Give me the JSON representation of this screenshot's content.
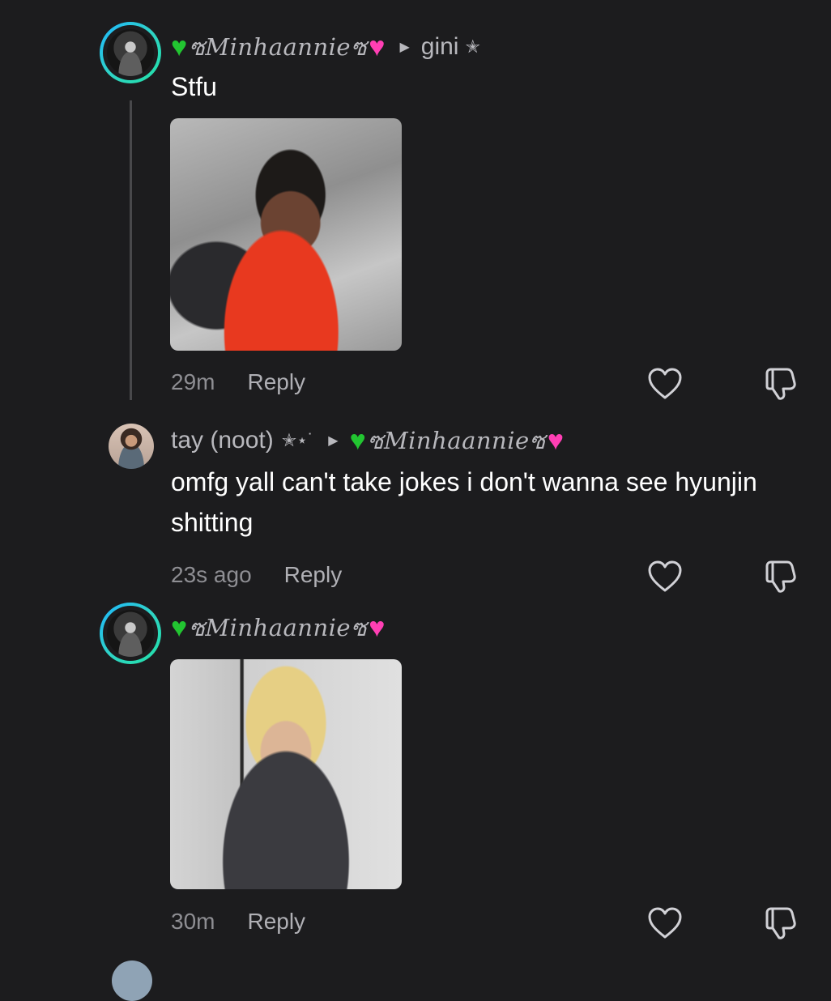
{
  "comments": [
    {
      "author": "Minhaannie",
      "reply_to": "gini",
      "text": "Stfu",
      "time": "29m",
      "reply_label": "Reply"
    },
    {
      "author": "tay (noot)",
      "author_suffix": "✭⋆˙",
      "reply_to": "Minhaannie",
      "text": "omfg yall can't take jokes i don't wanna see hyunjin shitting",
      "time": "23s ago",
      "reply_label": "Reply"
    },
    {
      "author": "Minhaannie",
      "time": "30m",
      "reply_label": "Reply"
    }
  ],
  "decor": {
    "fancy_left": "ซ",
    "fancy_right": "ซ",
    "green_heart": "♥",
    "pink_heart": "♥",
    "caret": "▶",
    "star": "✭"
  },
  "colors": {
    "background": "#1c1c1e",
    "ring_gradient_start": "#1fb6ff",
    "ring_gradient_end": "#22e0a6",
    "green_heart": "#22c531",
    "pink_heart": "#ff3fb4"
  }
}
